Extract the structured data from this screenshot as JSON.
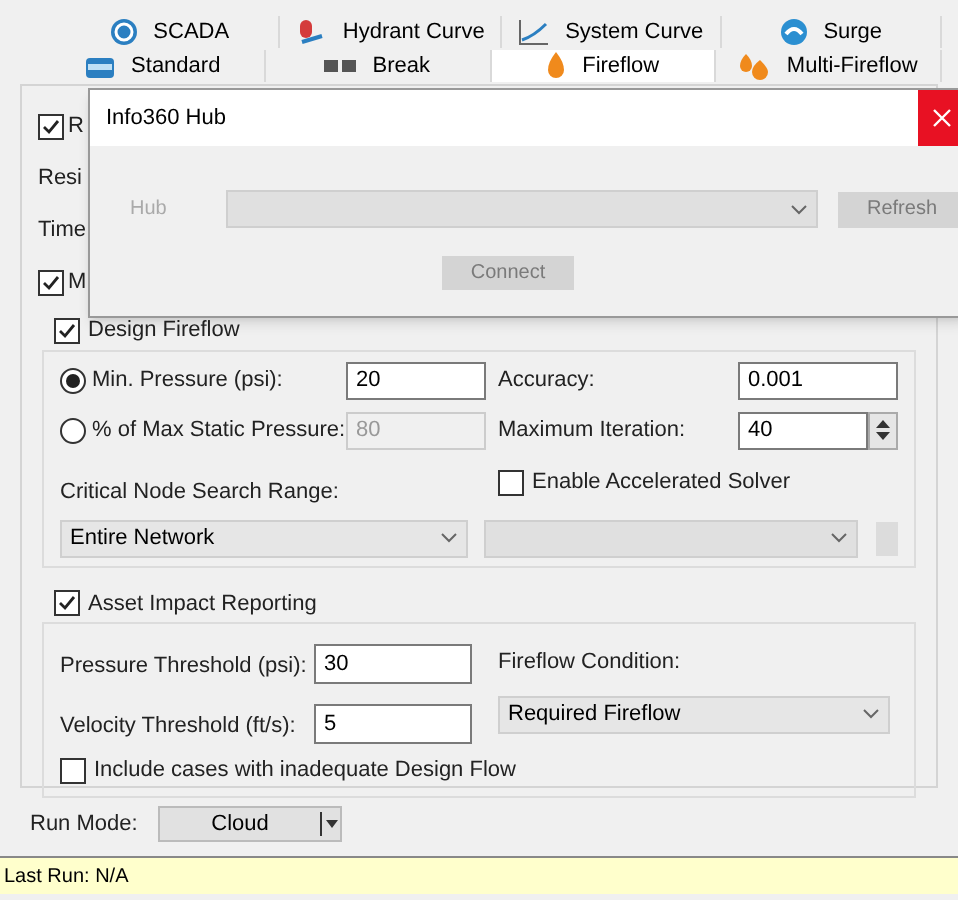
{
  "tabs_row_1": [
    {
      "label": "SCADA",
      "selected": false
    },
    {
      "label": "Hydrant Curve",
      "selected": false
    },
    {
      "label": "System Curve",
      "selected": false
    },
    {
      "label": "Surge",
      "selected": false
    }
  ],
  "tabs_row_2": [
    {
      "label": "Standard",
      "selected": false
    },
    {
      "label": "Break",
      "selected": false
    },
    {
      "label": "Fireflow",
      "selected": true
    },
    {
      "label": "Multi-Fireflow",
      "selected": false
    }
  ],
  "hidden_rows": [
    {
      "kind": "checkbox",
      "label": "R",
      "checked": true
    },
    {
      "kind": "text",
      "label": "Resi"
    },
    {
      "kind": "text",
      "label": "Time"
    },
    {
      "kind": "checkbox",
      "label": "M",
      "checked": true
    }
  ],
  "design_fireflow": {
    "label": "Design Fireflow",
    "checked": true,
    "pressure_options": [
      {
        "label": "Min. Pressure (psi):",
        "value": "20",
        "selected": true
      },
      {
        "label": "% of Max Static Pressure:",
        "value": "80",
        "selected": false
      }
    ],
    "accuracy": {
      "label": "Accuracy:",
      "value": "0.001"
    },
    "max_iteration": {
      "label": "Maximum Iteration:",
      "value": "40"
    },
    "accelerated_solver": {
      "label": "Enable Accelerated Solver",
      "checked": false
    },
    "search_range": {
      "label": "Critical Node Search Range:",
      "value": "Entire Network"
    }
  },
  "asset_impact": {
    "label": "Asset Impact Reporting",
    "checked": true,
    "pressure_threshold": {
      "label": "Pressure Threshold (psi):",
      "value": "30"
    },
    "velocity_threshold": {
      "label": "Velocity Threshold (ft/s):",
      "value": "5"
    },
    "fireflow_condition": {
      "label": "Fireflow Condition:",
      "value": "Required Fireflow"
    },
    "include_inadequate": {
      "label": "Include cases with inadequate Design Flow",
      "checked": false
    }
  },
  "run_mode": {
    "label": "Run Mode:",
    "value": "Cloud"
  },
  "status_bar": "Last Run: N/A",
  "dialog": {
    "title": "Info360 Hub",
    "hub_label": "Hub",
    "refresh": "Refresh",
    "connect": "Connect"
  }
}
